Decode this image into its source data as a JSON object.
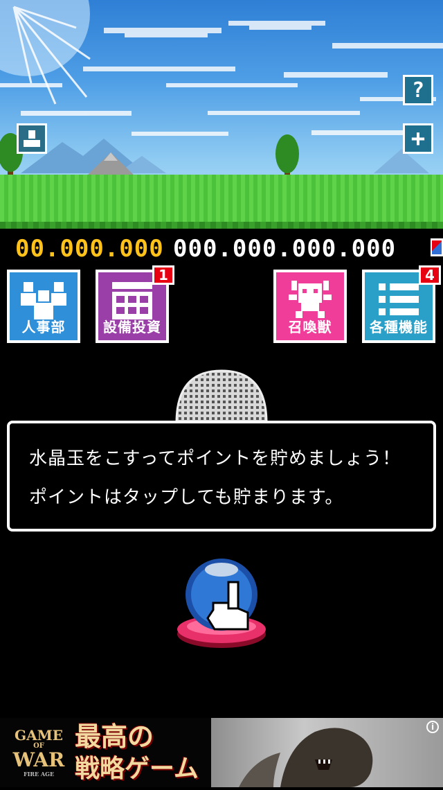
{
  "top_buttons": {
    "help_label": "?",
    "add_label": "+"
  },
  "counters": {
    "points": "00.000.000",
    "total": "000.000.000.000"
  },
  "menu": [
    {
      "label": "人事部",
      "color": "#2f8fd8",
      "badge": ""
    },
    {
      "label": "設備投資",
      "color": "#9a3fa8",
      "badge": "1"
    },
    {
      "label": "召喚獣",
      "color": "#f03d9a",
      "badge": ""
    },
    {
      "label": "各種機能",
      "color": "#2aa0c8",
      "badge": "4"
    }
  ],
  "dialog": {
    "line1": "水晶玉をこすってポイントを貯めましょう！",
    "line2": "ポイントはタップしても貯まります。"
  },
  "ad": {
    "logo_line1": "GAME",
    "logo_of": "OF",
    "logo_line2": "WAR",
    "logo_sub": "FIRE AGE",
    "headline1": "最高の",
    "headline2": "戦略ゲーム",
    "info_label": "i"
  },
  "colors": {
    "points": "#ffc21a",
    "total": "#ffffff"
  }
}
